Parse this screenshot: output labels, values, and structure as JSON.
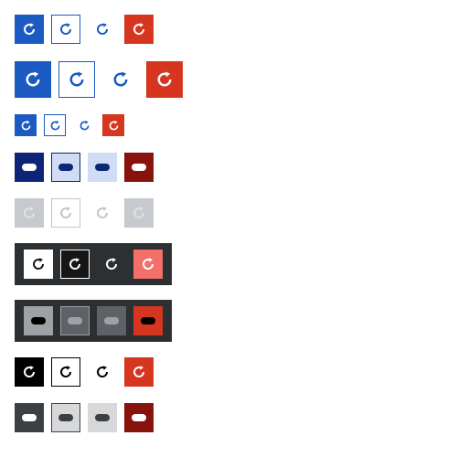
{
  "colors": {
    "primary": "#1a5ac2",
    "danger": "#d6361f",
    "pressed_primary": "#0c2576",
    "pressed_tint": "#cfdcf3",
    "pressed_danger": "#88130c",
    "disabled_fill": "#c6c9cd",
    "disabled_outline": "#c2c4c7",
    "inverse_panel": "#2d3033",
    "inverse_danger": "#f37068",
    "inverse_pressed_grey": "#9ea1a5",
    "inverse_pressed_dark": "#5e6166",
    "contrast_black": "#000000",
    "contrast_pressed_fill": "#3c4045",
    "contrast_pressed_tint": "#d6d8da"
  },
  "button_variants": [
    "primary",
    "secondary",
    "ghost",
    "danger"
  ],
  "icon_names": [
    "refresh-icon",
    "pressed-indicator-icon"
  ],
  "button_groups": [
    {
      "name": "default-medium",
      "state": "default",
      "size": "medium"
    },
    {
      "name": "default-large",
      "state": "default",
      "size": "large"
    },
    {
      "name": "default-small",
      "state": "default",
      "size": "small"
    },
    {
      "name": "pressed",
      "state": "pressed",
      "size": "medium"
    },
    {
      "name": "disabled",
      "state": "disabled",
      "size": "medium"
    },
    {
      "name": "inverse",
      "state": "default",
      "size": "medium",
      "theme": "inverse"
    },
    {
      "name": "inverse-pressed",
      "state": "pressed",
      "size": "medium",
      "theme": "inverse"
    },
    {
      "name": "high-contrast",
      "state": "default",
      "size": "medium",
      "theme": "high-contrast"
    },
    {
      "name": "high-contrast-pressed",
      "state": "pressed",
      "size": "medium",
      "theme": "high-contrast"
    }
  ]
}
